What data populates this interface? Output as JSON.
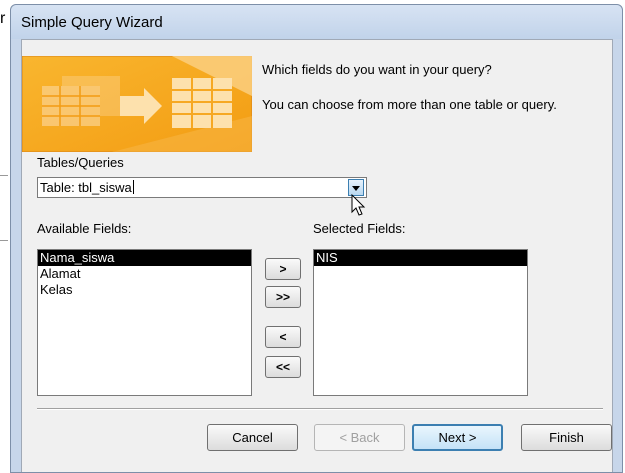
{
  "background": {
    "fragment": "r"
  },
  "window": {
    "title": "Simple Query Wizard"
  },
  "wizard": {
    "prompt_line1": "Which fields do you want in your query?",
    "prompt_line2": "You can choose from more than one table or query."
  },
  "tables_queries": {
    "label": "Tables/Queries",
    "selected_value": "Table: tbl_siswa"
  },
  "available_fields": {
    "label": "Available Fields:",
    "items": [
      {
        "label": "Nama_siswa",
        "selected": true
      },
      {
        "label": "Alamat",
        "selected": false
      },
      {
        "label": "Kelas",
        "selected": false
      }
    ]
  },
  "selected_fields": {
    "label": "Selected Fields:",
    "items": [
      {
        "label": "NIS",
        "selected": true
      }
    ]
  },
  "move_buttons": {
    "add_one": ">",
    "add_all": ">>",
    "remove_one": "<",
    "remove_all": "<<"
  },
  "footer_buttons": {
    "cancel": "Cancel",
    "back": "< Back",
    "next": "Next >",
    "finish": "Finish"
  },
  "colors": {
    "title_bar": "#c7d6ea",
    "banner_orange": "#f7a31c",
    "selection": "#000000",
    "default_button_border": "#3c7fb1"
  },
  "icons": {
    "banner": "table-to-query-illustration",
    "dropdown": "chevron-down-icon",
    "pointer": "mouse-pointer-icon"
  }
}
